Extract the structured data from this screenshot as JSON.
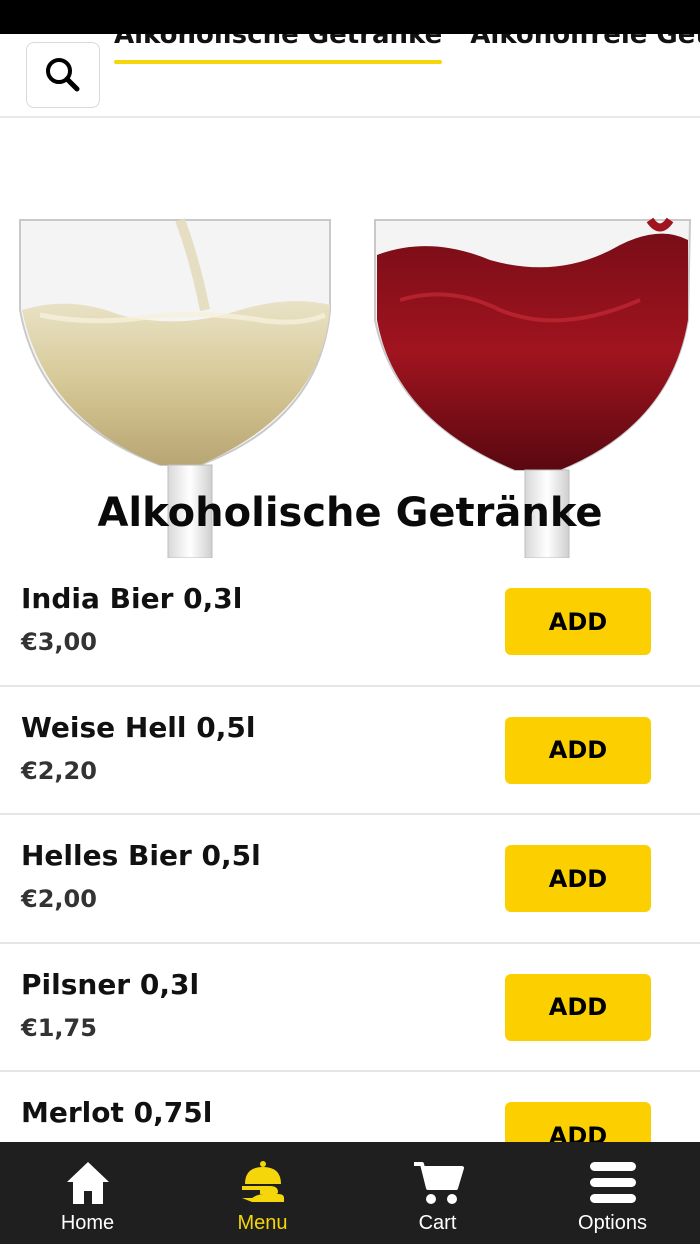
{
  "tabs": [
    {
      "label": "Alkoholische Getränke",
      "active": true
    },
    {
      "label": "Alkoholfreie Getränke",
      "active": false
    }
  ],
  "hero": {
    "title": "Alkoholische Getränke"
  },
  "menu_items": [
    {
      "name": "India Bier 0,3l",
      "price": "€3,00",
      "add_label": "ADD"
    },
    {
      "name": "Weise Hell 0,5l",
      "price": "€2,20",
      "add_label": "ADD"
    },
    {
      "name": "Helles Bier 0,5l",
      "price": "€2,00",
      "add_label": "ADD"
    },
    {
      "name": "Pilsner 0,3l",
      "price": "€1,75",
      "add_label": "ADD"
    },
    {
      "name": "Merlot 0,75l",
      "price": "",
      "add_label": "ADD"
    }
  ],
  "bottom_nav": [
    {
      "label": "Home",
      "icon": "home-icon",
      "active": false
    },
    {
      "label": "Menu",
      "icon": "food-tray-icon",
      "active": true
    },
    {
      "label": "Cart",
      "icon": "cart-icon",
      "active": false
    },
    {
      "label": "Options",
      "icon": "menu-icon",
      "active": false
    }
  ],
  "colors": {
    "accent": "#fcd000",
    "nav_background": "#1f1f1f",
    "active_nav": "#f5d60a"
  }
}
